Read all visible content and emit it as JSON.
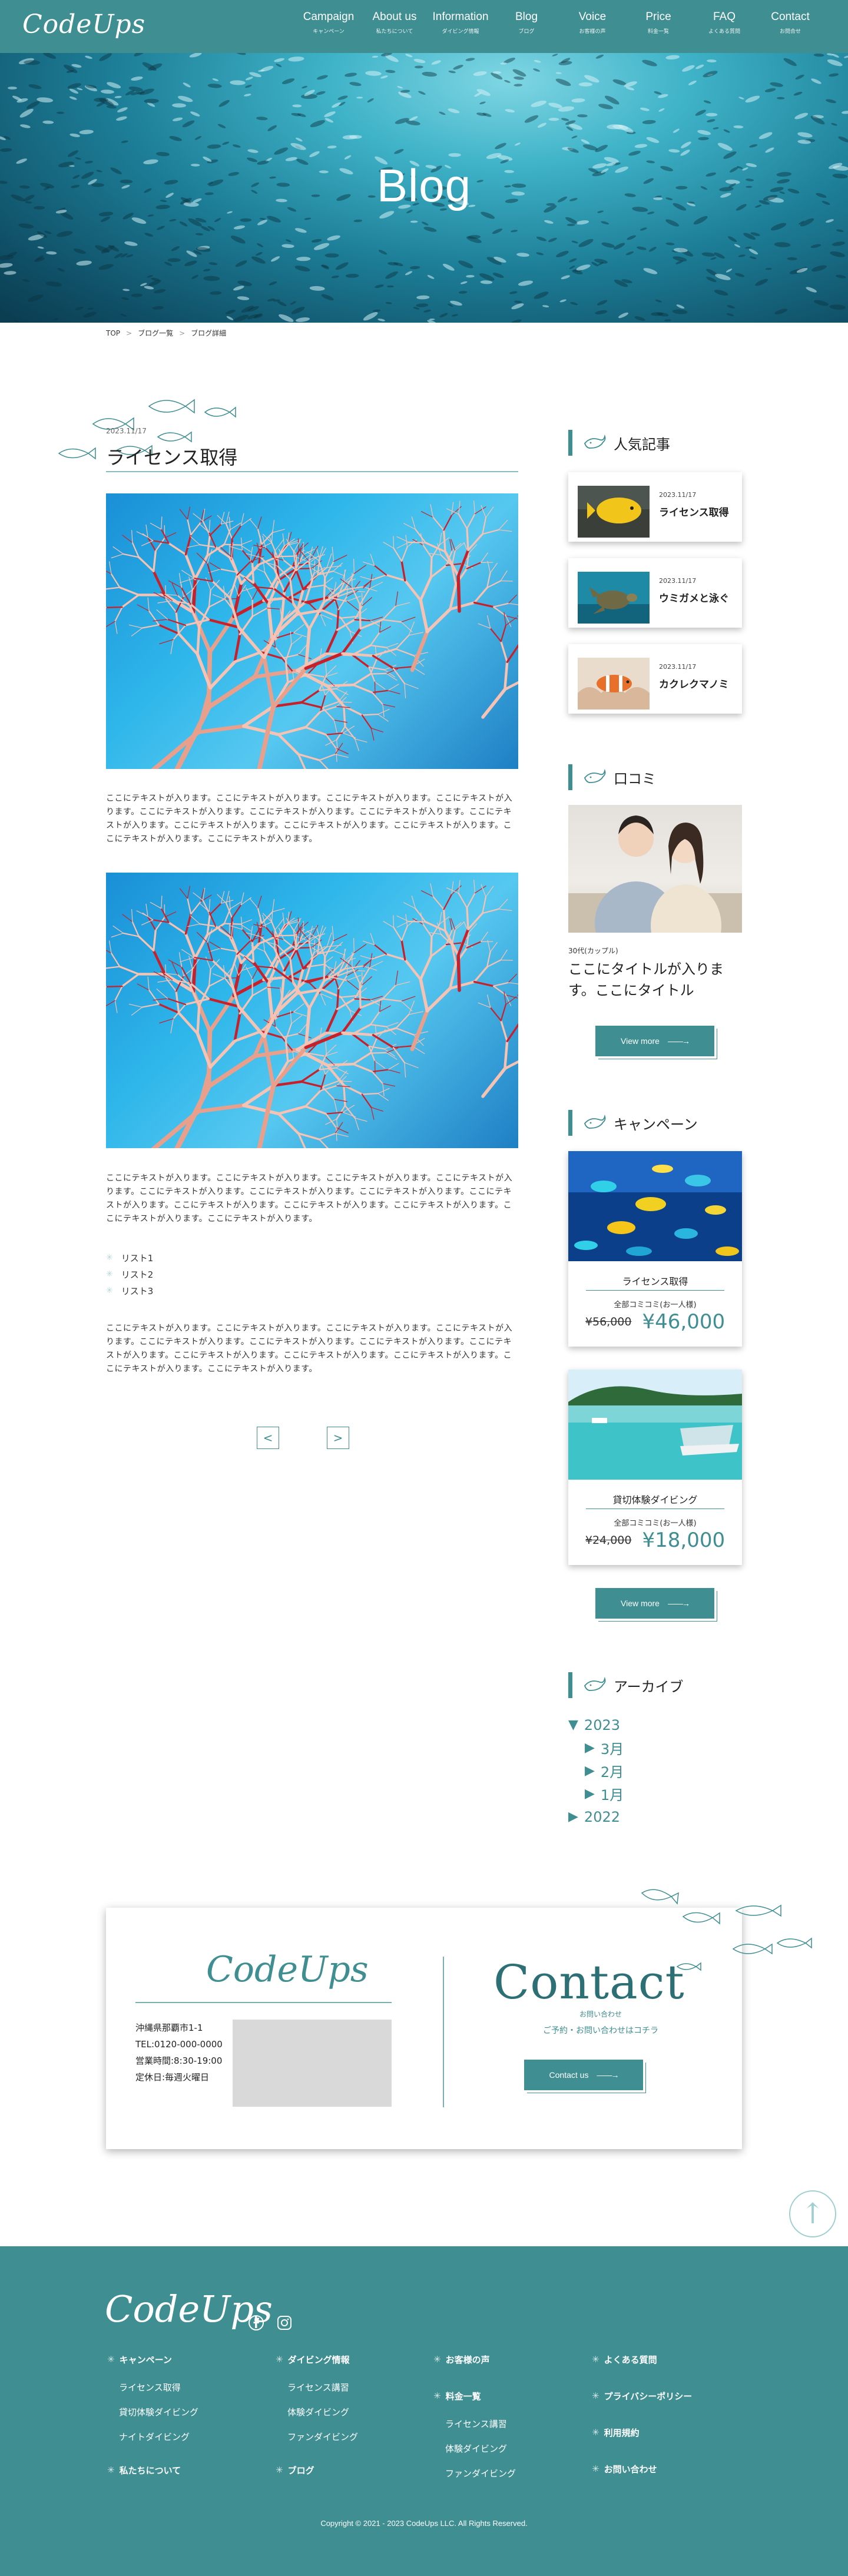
{
  "header": {
    "logo": "CodeUps",
    "nav": [
      {
        "en": "Campaign",
        "jp": "キャンペーン"
      },
      {
        "en": "About us",
        "jp": "私たちについて"
      },
      {
        "en": "Information",
        "jp": "ダイビング情報"
      },
      {
        "en": "Blog",
        "jp": "ブログ"
      },
      {
        "en": "Voice",
        "jp": "お客様の声"
      },
      {
        "en": "Price",
        "jp": "料金一覧"
      },
      {
        "en": "FAQ",
        "jp": "よくある質問"
      },
      {
        "en": "Contact",
        "jp": "お問合せ"
      }
    ]
  },
  "hero": {
    "title": "Blog"
  },
  "breadcrumb": {
    "items": [
      "TOP",
      "ブログ一覧",
      "ブログ詳細"
    ],
    "sep": ">"
  },
  "article": {
    "date": "2023.11/17",
    "title": "ライセンス取得",
    "para1": "ここにテキストが入ります。ここにテキストが入ります。ここにテキストが入ります。ここにテキストが入ります。ここにテキストが入ります。ここにテキストが入ります。ここにテキストが入ります。ここにテキストが入ります。ここにテキストが入ります。ここにテキストが入ります。ここにテキストが入ります。ここにテキストが入ります。ここにテキストが入ります。",
    "para2": "ここにテキストが入ります。ここにテキストが入ります。ここにテキストが入ります。ここにテキストが入ります。ここにテキストが入ります。ここにテキストが入ります。ここにテキストが入ります。ここにテキストが入ります。ここにテキストが入ります。ここにテキストが入ります。ここにテキストが入ります。ここにテキストが入ります。ここにテキストが入ります。",
    "list": [
      "リスト1",
      "リスト2",
      "リスト3"
    ],
    "para3": "ここにテキストが入ります。ここにテキストが入ります。ここにテキストが入ります。ここにテキストが入ります。ここにテキストが入ります。ここにテキストが入ります。ここにテキストが入ります。ここにテキストが入ります。ここにテキストが入ります。ここにテキストが入ります。ここにテキストが入ります。ここにテキストが入ります。ここにテキストが入ります。",
    "prev": "<",
    "next": ">"
  },
  "sidebar": {
    "popular": {
      "heading": "人気記事",
      "items": [
        {
          "date": "2023.11/17",
          "title": "ライセンス取得"
        },
        {
          "date": "2023.11/17",
          "title": "ウミガメと泳ぐ"
        },
        {
          "date": "2023.11/17",
          "title": "カクレクマノミ"
        }
      ]
    },
    "review": {
      "heading": "口コミ",
      "meta": "30代(カップル)",
      "title": "ここにタイトルが入ります。ここにタイトル",
      "button": "View more"
    },
    "campaign": {
      "heading": "キャンペーン",
      "items": [
        {
          "name": "ライセンス取得",
          "sub": "全部コミコミ(お一人様)",
          "old": "¥56,000",
          "price": "¥46,000"
        },
        {
          "name": "貸切体験ダイビング",
          "sub": "全部コミコミ(お一人様)",
          "old": "¥24,000",
          "price": "¥18,000"
        }
      ],
      "button": "View more"
    },
    "archive": {
      "heading": "アーカイブ",
      "year1": "2023",
      "months": [
        "3月",
        "2月",
        "1月"
      ],
      "year2": "2022",
      "open": "▼",
      "closed": "▶"
    }
  },
  "contact": {
    "logo": "CodeUps",
    "address": [
      "沖縄県那覇市1-1",
      "TEL:0120-000-0000",
      "営業時間:8:30-19:00",
      "定休日:毎週火曜日"
    ],
    "title": "Contact",
    "sub": "お問い合わせ",
    "desc": "ご予約・お問い合わせはコチラ",
    "button": "Contact us"
  },
  "pagetop": {
    "label": "↑"
  },
  "footer": {
    "logo": "CodeUps",
    "col1": {
      "h1": "キャンペーン",
      "items": [
        "ライセンス取得",
        "貸切体験ダイビング",
        "ナイトダイビング"
      ],
      "h2": "私たちについて"
    },
    "col2": {
      "h1": "ダイビング情報",
      "items": [
        "ライセンス講習",
        "体験ダイビング",
        "ファンダイビング"
      ],
      "h2": "ブログ"
    },
    "col3": {
      "h1": "お客様の声",
      "h2": "料金一覧",
      "items": [
        "ライセンス講習",
        "体験ダイビング",
        "ファンダイビング"
      ]
    },
    "col4": {
      "h1": "よくある質問",
      "h2": "プライバシーポリシー",
      "h3": "利用規約",
      "h4": "お問い合わせ"
    },
    "copyright": "Copyright © 2021 - 2023 CodeUps LLC. All Rights Reserved."
  },
  "colors": {
    "accent": "#3f8e91",
    "price": "#3f8e91"
  }
}
